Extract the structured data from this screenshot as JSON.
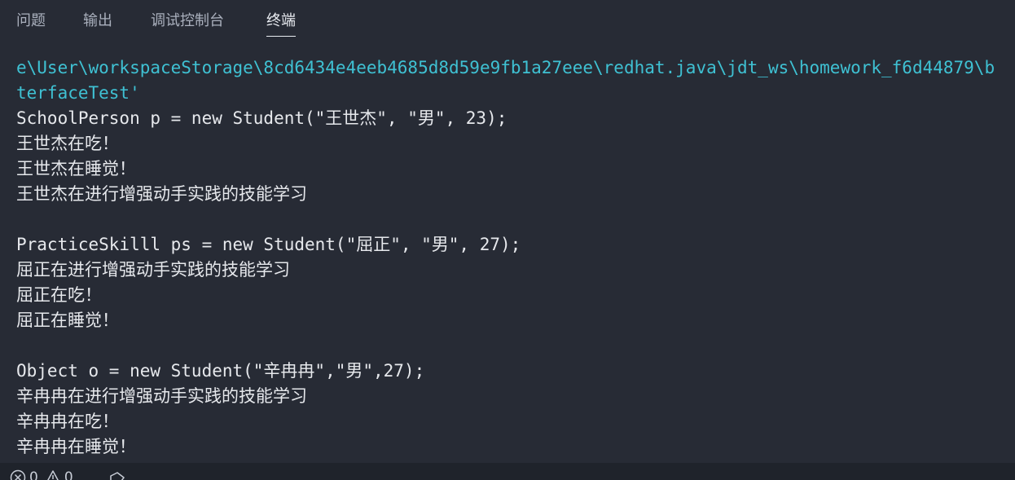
{
  "tabs": [
    {
      "label": "问题",
      "active": false
    },
    {
      "label": "输出",
      "active": false
    },
    {
      "label": "调试控制台",
      "active": false
    },
    {
      "label": "终端",
      "active": true
    }
  ],
  "terminal": {
    "lines": [
      {
        "text": "e\\User\\workspaceStorage\\8cd6434e4eeb4685d8d59e9fb1a27eee\\redhat.java\\jdt_ws\\homework_f6d44879\\b",
        "kind": "path"
      },
      {
        "text": "terfaceTest'",
        "kind": "path"
      },
      {
        "text": "SchoolPerson p = new Student(\"王世杰\", \"男\", 23);",
        "kind": "code"
      },
      {
        "text": "王世杰在吃！",
        "kind": "output"
      },
      {
        "text": "王世杰在睡觉！",
        "kind": "output"
      },
      {
        "text": "王世杰在进行增强动手实践的技能学习",
        "kind": "output"
      },
      {
        "text": "",
        "kind": "blank"
      },
      {
        "text": "PracticeSkilll ps = new Student(\"屈正\", \"男\", 27);",
        "kind": "code"
      },
      {
        "text": "屈正在进行增强动手实践的技能学习",
        "kind": "output"
      },
      {
        "text": "屈正在吃！",
        "kind": "output"
      },
      {
        "text": "屈正在睡觉！",
        "kind": "output"
      },
      {
        "text": "",
        "kind": "blank"
      },
      {
        "text": "Object o = new Student(\"辛冉冉\",\"男\",27);",
        "kind": "code"
      },
      {
        "text": "辛冉冉在进行增强动手实践的技能学习",
        "kind": "output"
      },
      {
        "text": "辛冉冉在吃！",
        "kind": "output"
      },
      {
        "text": "辛冉冉在睡觉！",
        "kind": "output"
      }
    ]
  },
  "statusbar": {
    "errors_icon": "error-circle-icon",
    "errors_count": "0",
    "warnings_icon": "warning-triangle-icon",
    "warnings_count": "0",
    "ports_icon": "ports-icon"
  },
  "colors": {
    "background": "#272b35",
    "path_text": "#3fc1d3",
    "text": "#e6e8ec",
    "tab_inactive": "#aab0bd",
    "tab_active": "#e8ebf0"
  }
}
